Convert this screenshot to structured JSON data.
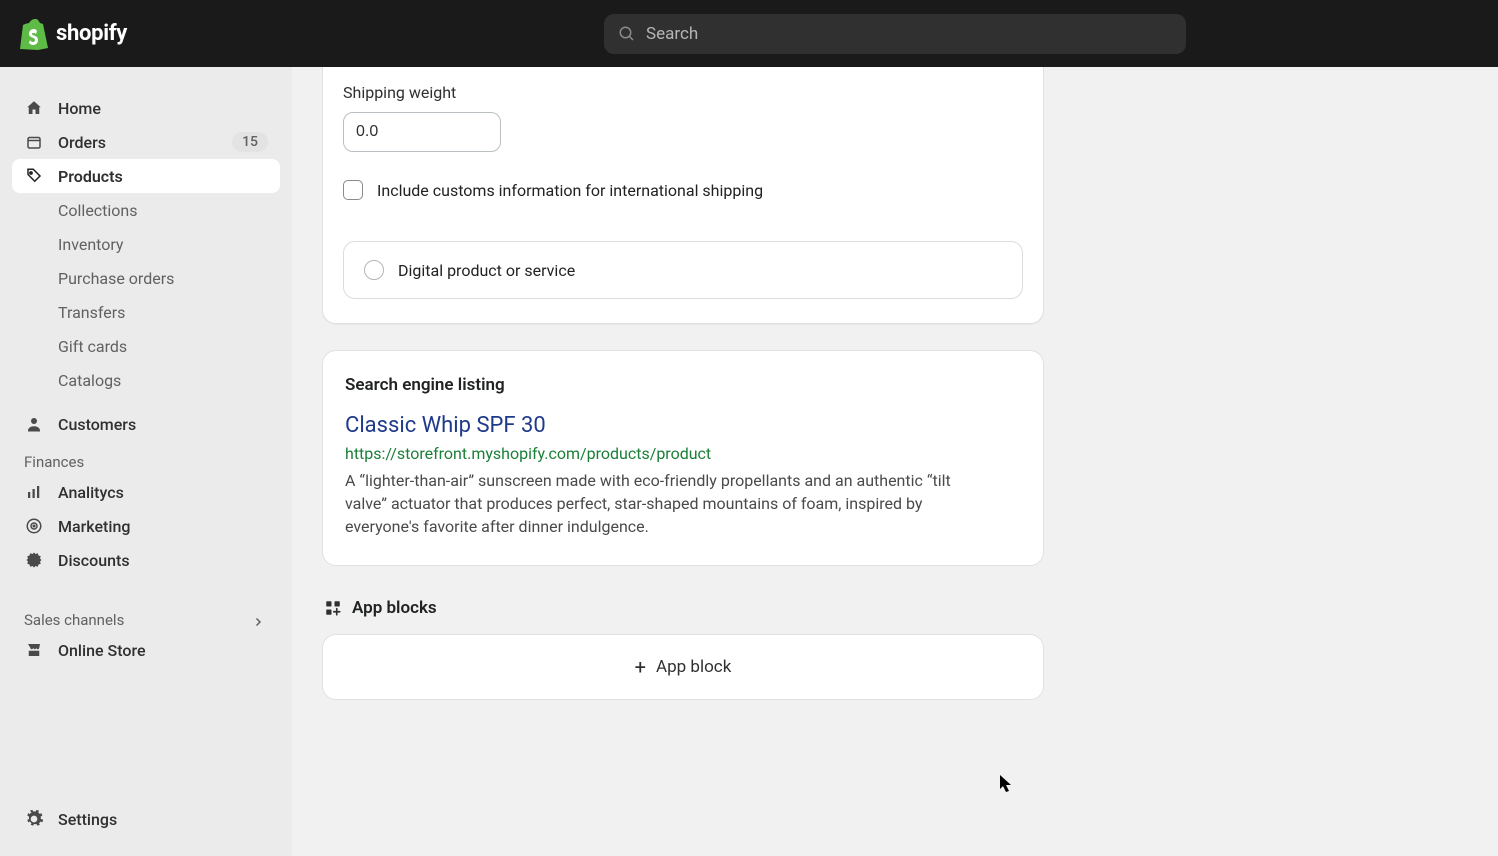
{
  "header": {
    "brand": "shopify",
    "search_placeholder": "Search"
  },
  "sidebar": {
    "home": "Home",
    "orders": "Orders",
    "orders_badge": "15",
    "products": "Products",
    "products_children": {
      "collections": "Collections",
      "inventory": "Inventory",
      "purchase_orders": "Purchase orders",
      "transfers": "Transfers",
      "gift_cards": "Gift cards",
      "catalogs": "Catalogs"
    },
    "customers": "Customers",
    "finances": "Finances",
    "analytics": "Analitycs",
    "marketing": "Marketing",
    "discounts": "Discounts",
    "sales_channels": "Sales channels",
    "online_store": "Online Store",
    "settings": "Settings"
  },
  "shipping": {
    "weight_label": "Shipping weight",
    "weight_value": "0.0",
    "customs_checkbox_label": "Include customs information for international shipping",
    "digital_radio_label": "Digital product or service"
  },
  "seo": {
    "heading": "Search engine listing",
    "title": "Classic Whip SPF 30",
    "url": "https://storefront.myshopify.com/products/product",
    "description": "A “lighter-than-air” sunscreen made with eco-friendly propellants and an authentic “tilt valve” actuator that produces perfect, star-shaped mountains of foam, inspired by everyone's favorite after dinner indulgence."
  },
  "app_blocks": {
    "heading": "App blocks",
    "add_label": "App block"
  }
}
